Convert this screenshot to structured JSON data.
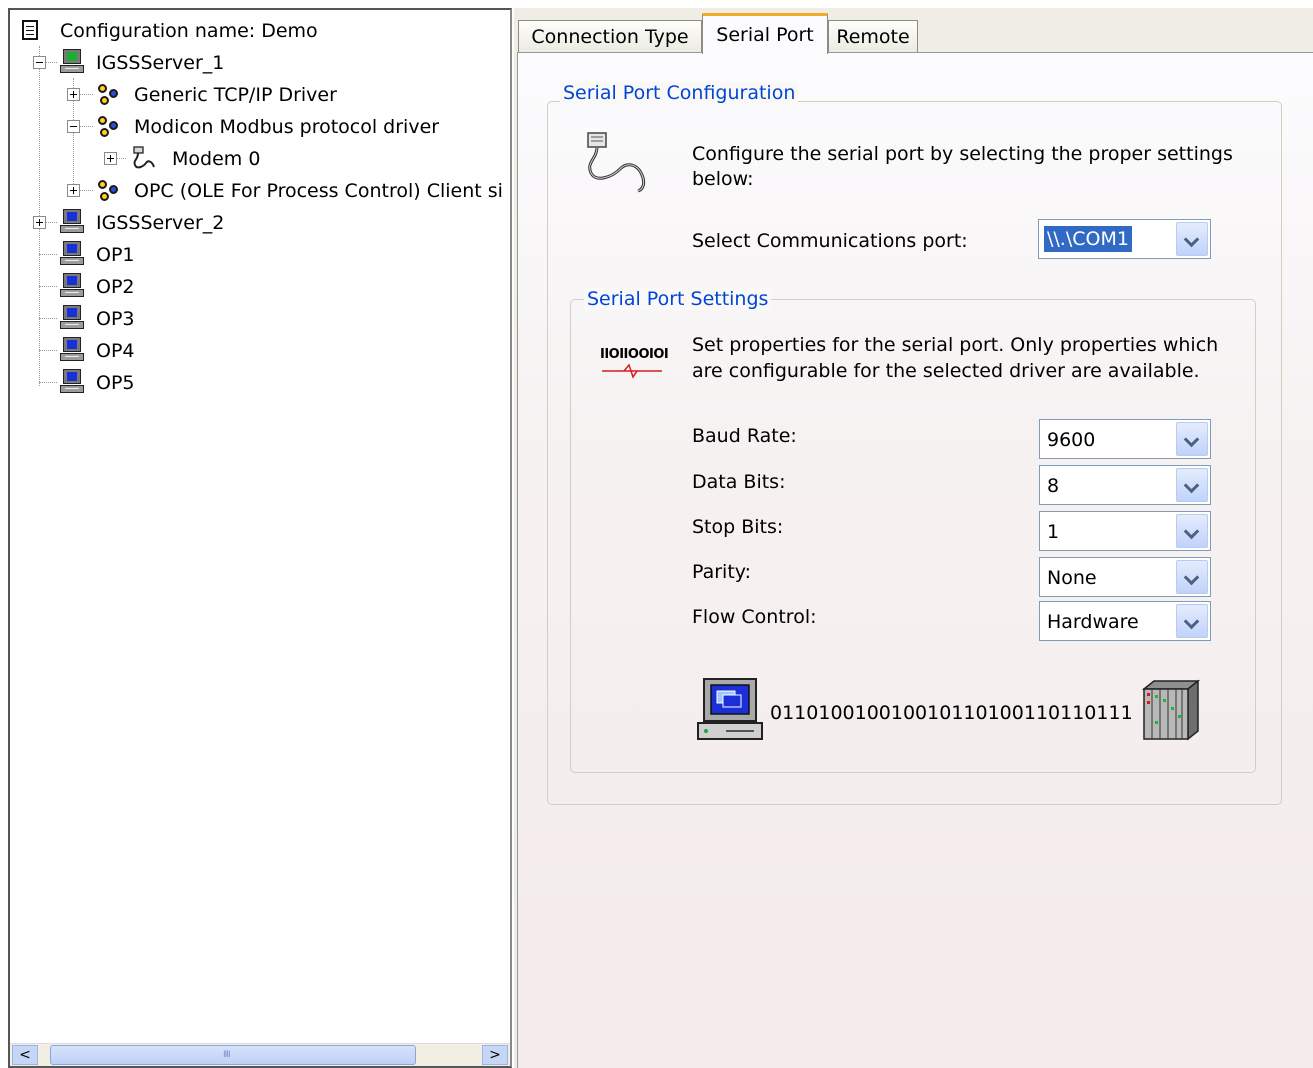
{
  "tree": {
    "root_label": "Configuration name: Demo",
    "items": [
      {
        "label": "IGSSServer_1"
      },
      {
        "label": "Generic TCP/IP Driver"
      },
      {
        "label": "Modicon Modbus protocol driver"
      },
      {
        "label": "Modem 0"
      },
      {
        "label": "OPC (OLE For Process Control) Client si"
      },
      {
        "label": "IGSSServer_2"
      },
      {
        "label": "OP1"
      },
      {
        "label": "OP2"
      },
      {
        "label": "OP3"
      },
      {
        "label": "OP4"
      },
      {
        "label": "OP5"
      }
    ],
    "scroll_left": "<",
    "scroll_right": ">"
  },
  "tabs": [
    "Connection Type",
    "Serial Port",
    "Remote"
  ],
  "active_tab": "Serial Port",
  "serial_config": {
    "legend": "Serial Port Configuration",
    "description_line1": "Configure the serial port by selecting the proper settings",
    "description_line2": "below:",
    "port_label": "Select Communications port:",
    "port_value": "\\\\.\\COM1"
  },
  "serial_settings": {
    "legend": "Serial Port Settings",
    "description_line1": "Set properties for the serial port. Only properties which",
    "description_line2": "are configurable for the selected driver are available.",
    "icon_text": "IIOIIOOIOI",
    "fields": [
      {
        "label": "Baud Rate:",
        "value": "9600"
      },
      {
        "label": "Data Bits:",
        "value": "8"
      },
      {
        "label": "Stop Bits:",
        "value": "1"
      },
      {
        "label": "Parity:",
        "value": "None"
      },
      {
        "label": "Flow Control:",
        "value": "Hardware"
      }
    ],
    "binary_text": "011010010010010110100110110111"
  }
}
